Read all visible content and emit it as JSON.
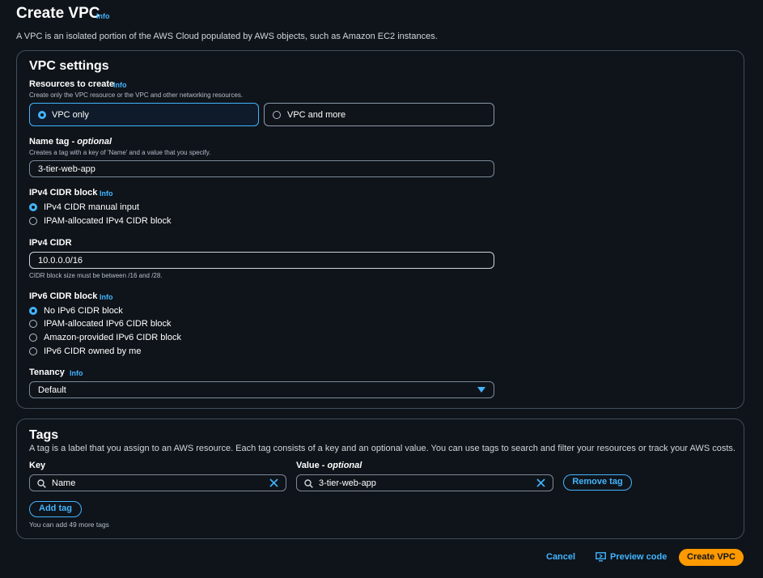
{
  "page": {
    "title": "Create VPC",
    "info": "Info",
    "description": "A VPC is an isolated portion of the AWS Cloud populated by AWS objects, such as Amazon EC2 instances."
  },
  "vpc_settings": {
    "title": "VPC settings",
    "resources": {
      "label": "Resources to create",
      "info": "Info",
      "hint": "Create only the VPC resource or the VPC and other networking resources.",
      "options": [
        "VPC only",
        "VPC and more"
      ],
      "selected": "VPC only"
    },
    "name_tag": {
      "label": "Name tag - ",
      "optional": "optional",
      "hint": "Creates a tag with a key of 'Name' and a value that you specify.",
      "value": "3-tier-web-app"
    },
    "ipv4_block": {
      "label": "IPv4 CIDR block",
      "info": "Info",
      "options": [
        "IPv4 CIDR manual input",
        "IPAM-allocated IPv4 CIDR block"
      ],
      "selected": "IPv4 CIDR manual input"
    },
    "ipv4_cidr": {
      "label": "IPv4 CIDR",
      "value": "10.0.0.0/16",
      "hint": "CIDR block size must be between /16 and /28."
    },
    "ipv6_block": {
      "label": "IPv6 CIDR block",
      "info": "Info",
      "options": [
        "No IPv6 CIDR block",
        "IPAM-allocated IPv6 CIDR block",
        "Amazon-provided IPv6 CIDR block",
        "IPv6 CIDR owned by me"
      ],
      "selected": "No IPv6 CIDR block"
    },
    "tenancy": {
      "label": "Tenancy",
      "info": "Info",
      "value": "Default"
    }
  },
  "tags": {
    "title": "Tags",
    "description": "A tag is a label that you assign to an AWS resource. Each tag consists of a key and an optional value. You can use tags to search and filter your resources or track your AWS costs.",
    "key_label": "Key",
    "value_label": "Value - ",
    "value_optional": "optional",
    "key_value": "Name",
    "value_value": "3-tier-web-app",
    "remove_label": "Remove tag",
    "add_label": "Add tag",
    "remaining_hint": "You can add 49 more tags"
  },
  "footer": {
    "cancel": "Cancel",
    "preview": "Preview code",
    "create": "Create VPC"
  },
  "colors": {
    "accent": "#42b4ff",
    "primary": "#ff9900",
    "background": "#0f141a"
  }
}
